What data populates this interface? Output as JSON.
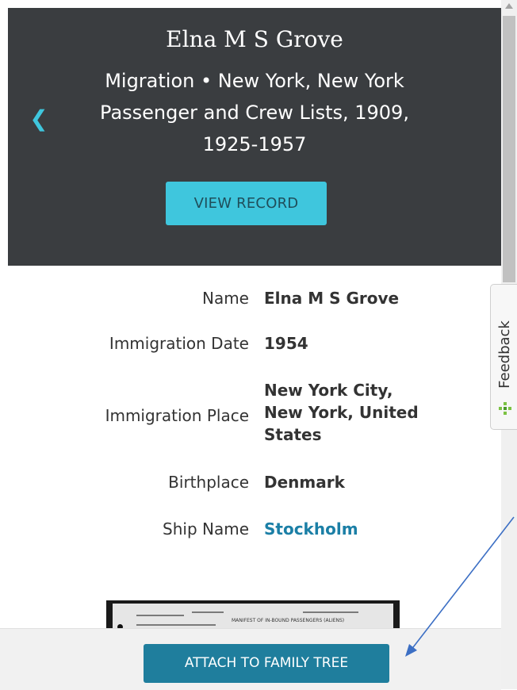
{
  "header": {
    "title": "Elna M S Grove",
    "subtitle_line1": "Migration • New York, New York",
    "subtitle_line2": "Passenger and Crew Lists, 1909,",
    "subtitle_line3": "1925-1957",
    "view_record_label": "VIEW RECORD",
    "back_icon": "chevron-left-icon"
  },
  "details": [
    {
      "label": "Name",
      "value": "Elna M S Grove"
    },
    {
      "label": "Immigration Date",
      "value": "1954"
    },
    {
      "label": "Immigration Place",
      "value_lines": [
        "New York City,",
        "New York, United",
        "States"
      ]
    },
    {
      "label": "Birthplace",
      "value": "Denmark"
    },
    {
      "label": "Ship Name",
      "value": "Stockholm",
      "is_link": true
    }
  ],
  "footer": {
    "attach_label": "ATTACH TO FAMILY TREE"
  },
  "feedback": {
    "label": "Feedback"
  },
  "thumbnail": {
    "header_text": "MANIFEST OF IN-BOUND PASSENGERS (ALIENS)"
  },
  "colors": {
    "header_bg": "#3a3d40",
    "accent": "#3fc6dd",
    "link": "#1b7fa6",
    "attach_button": "#1f7e9d",
    "annotation_arrow": "#3c6fc4"
  }
}
